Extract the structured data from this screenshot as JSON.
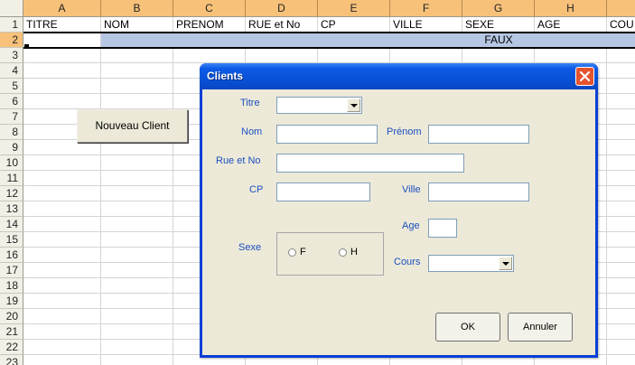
{
  "sheet": {
    "columns": [
      "A",
      "B",
      "C",
      "D",
      "E",
      "F",
      "G",
      "H"
    ],
    "rows": [
      "1",
      "2",
      "3",
      "4",
      "5",
      "6",
      "7",
      "8",
      "9",
      "10",
      "11",
      "12",
      "13",
      "14",
      "15",
      "16",
      "17",
      "18",
      "19",
      "20",
      "21",
      "22",
      "23"
    ],
    "row1": [
      "TITRE",
      "NOM",
      "PRENOM",
      "RUE et No",
      "CP",
      "VILLE",
      "SEXE",
      "AGE",
      "COU"
    ],
    "row2_value": "FAUX",
    "new_client_button": "Nouveau Client"
  },
  "dialog": {
    "title": "Clients",
    "labels": {
      "titre": "Titre",
      "nom": "Nom",
      "prenom": "Prénom",
      "rue": "Rue et No",
      "cp": "CP",
      "ville": "Ville",
      "age": "Age",
      "sexe": "Sexe",
      "cours": "Cours"
    },
    "radio_f": "F",
    "radio_h": "H",
    "ok_button": "OK",
    "cancel_button": "Annuler"
  },
  "colors": {
    "title_bar": "#0752d8",
    "close_button": "#e5532f",
    "label_text": "#1b4fc0",
    "selection_band": "#b6c7e4",
    "column_header": "#f7c17a"
  }
}
